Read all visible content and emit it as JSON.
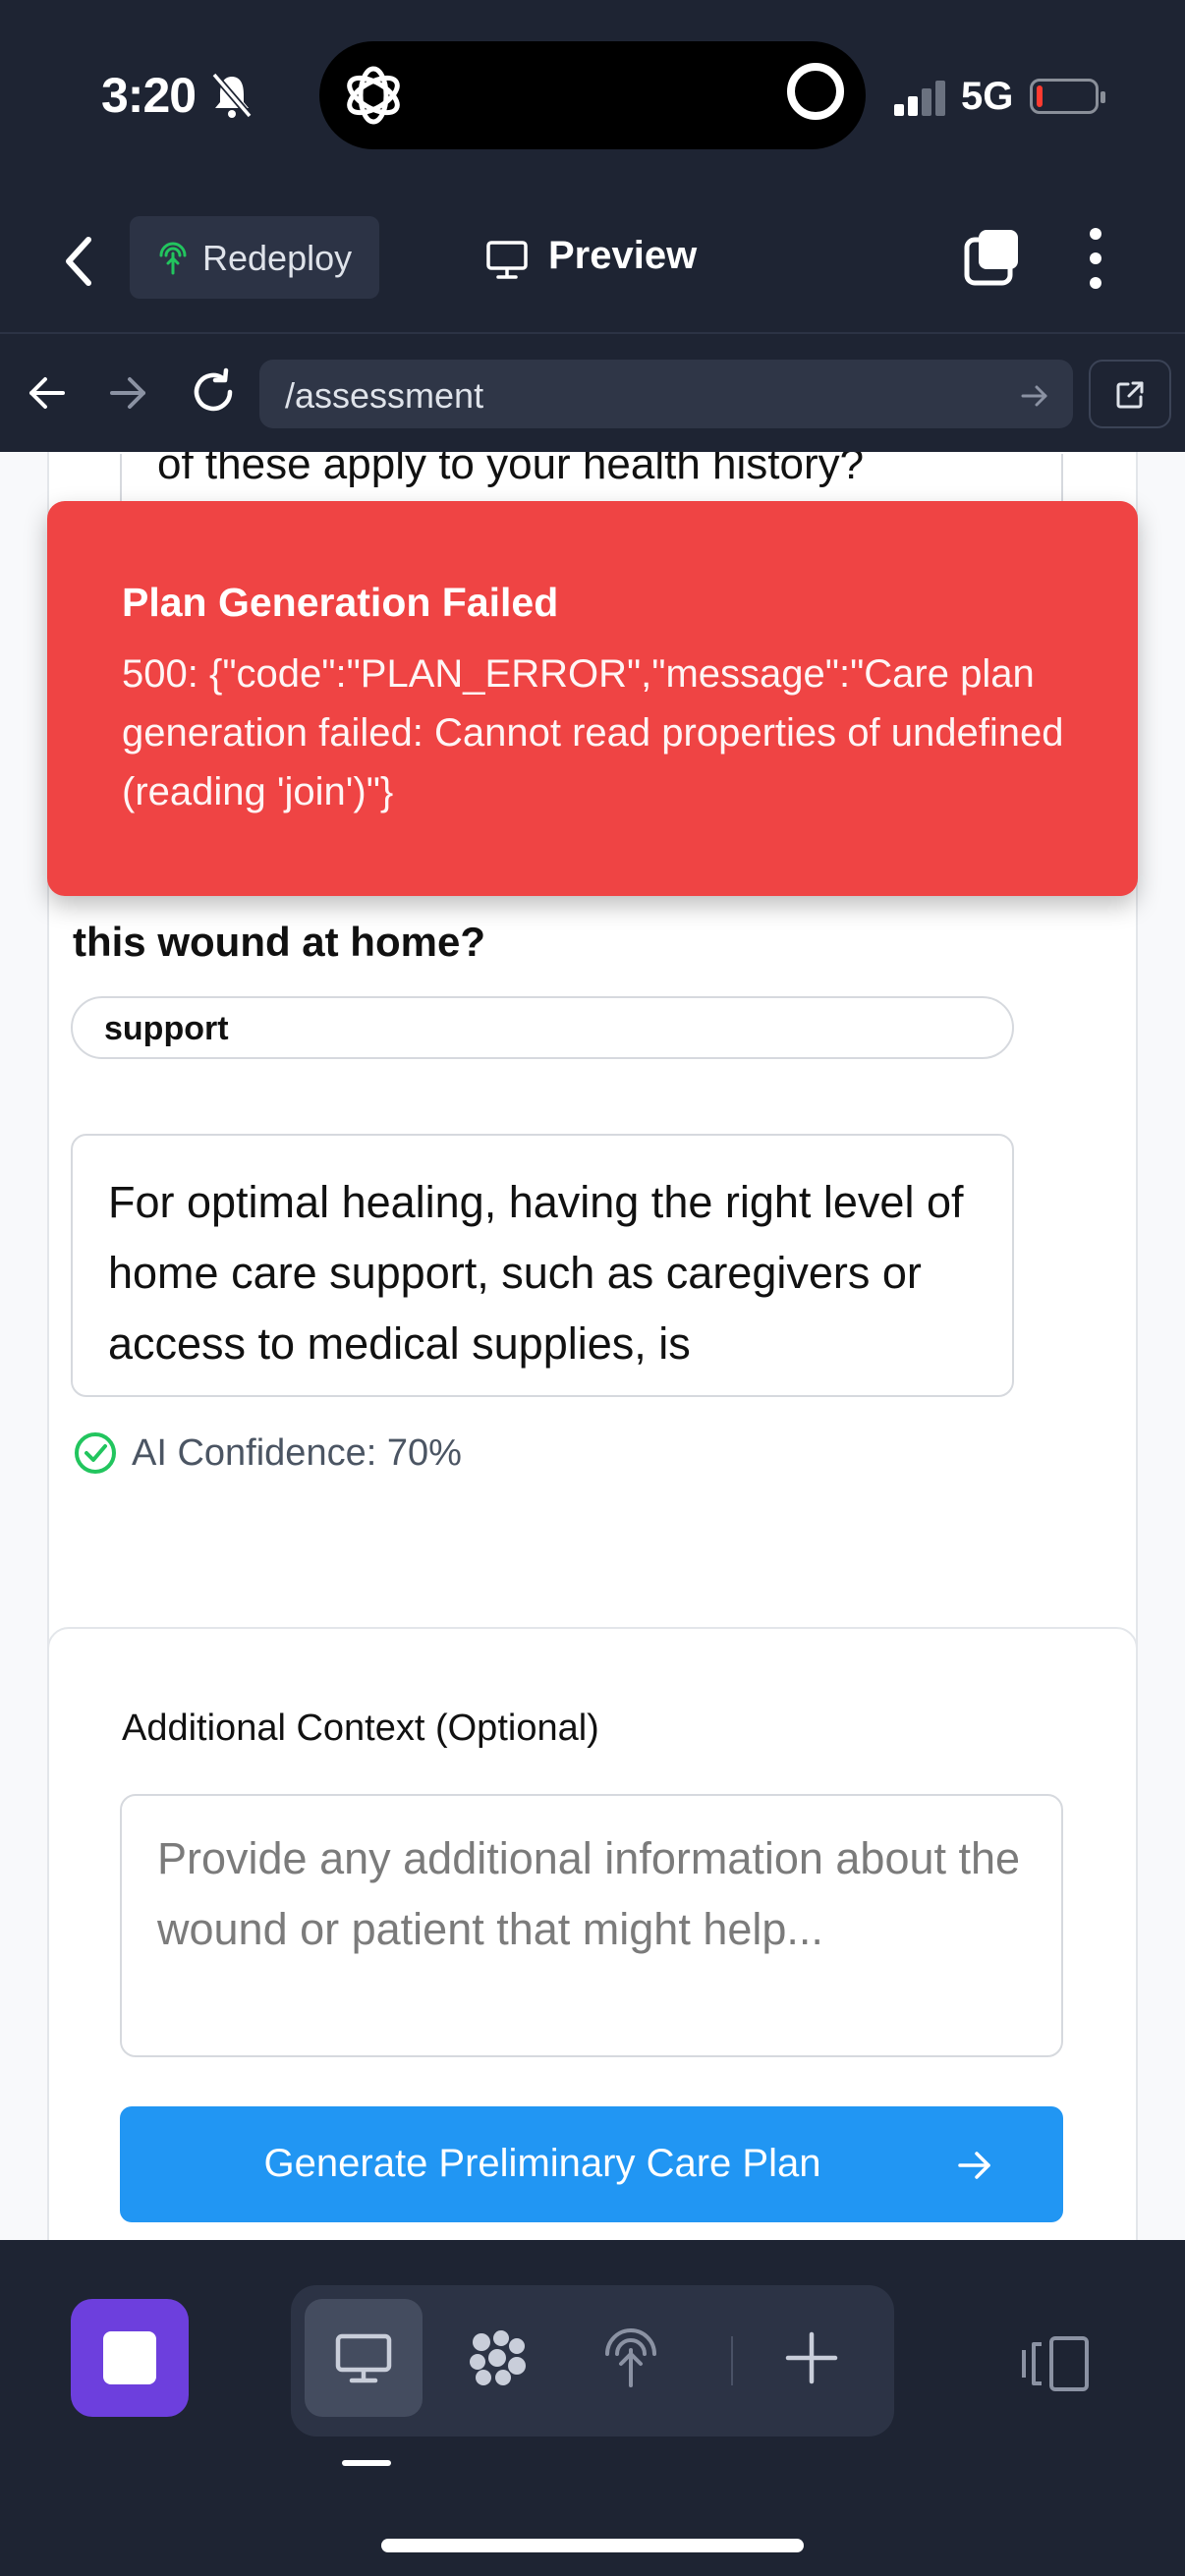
{
  "status_bar": {
    "time": "3:20",
    "network": "5G",
    "battery_level_percent": 10,
    "battery_color": "#ff3b30"
  },
  "header": {
    "redeploy_label": "Redeploy",
    "preview_label": "Preview"
  },
  "url_bar": {
    "url": "/assessment"
  },
  "assessment": {
    "previous_question_tail": "of these apply to your health history?",
    "question": "this wound at home?",
    "answer_chip": "support",
    "answer_explanation": "For optimal healing, having the right level of home care support, such as caregivers or access to medical supplies, is",
    "confidence": "AI Confidence: 70%"
  },
  "context": {
    "label": "Additional Context (Optional)",
    "placeholder": "Provide any additional information about the wound or patient that might help...",
    "generate_button": "Generate Preliminary Care Plan"
  },
  "toast": {
    "title": "Plan Generation Failed",
    "message": "500: {\"code\":\"PLAN_ERROR\",\"message\":\"Care plan generation failed: Cannot read properties of undefined (reading 'join')\"}",
    "color": "#ef4444"
  },
  "colors": {
    "accent": "#2196f3",
    "chrome": "#1e2433",
    "app_icon": "#6d3fdd",
    "success": "#22c55e"
  },
  "icons": [
    "bell-slash-icon",
    "chatgpt-logo-icon",
    "recording-ring-icon",
    "signal-icon",
    "battery-icon",
    "chevron-left-icon",
    "redeploy-icon",
    "monitor-icon",
    "tabs-icon",
    "more-vertical-icon",
    "arrow-left-icon",
    "arrow-right-icon",
    "reload-icon",
    "go-arrow-icon",
    "external-link-icon",
    "check-circle-icon",
    "arrow-right-icon",
    "app-stop-icon",
    "desktop-icon",
    "workspaces-icon",
    "deploy-icon",
    "plus-icon",
    "panel-icon"
  ]
}
